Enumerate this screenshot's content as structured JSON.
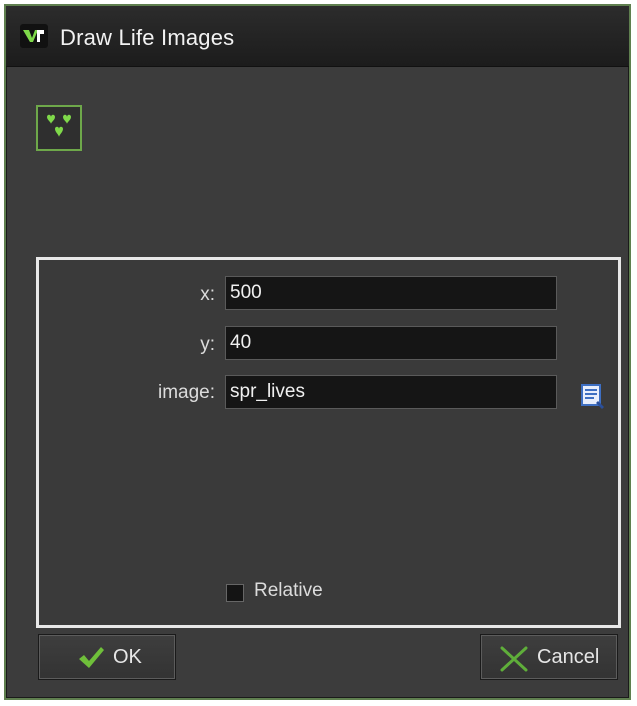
{
  "window": {
    "title": "Draw Life Images",
    "title_icon": "game-maker-icon",
    "action_icon": "life-images-icon"
  },
  "fields": {
    "x": {
      "label": "x:",
      "value": "500"
    },
    "y": {
      "label": "y:",
      "value": "40"
    },
    "image": {
      "label": "image:",
      "value": "spr_lives",
      "browse_icon": "browse-sprite-icon"
    }
  },
  "relative": {
    "label": "Relative",
    "checked": false
  },
  "buttons": {
    "ok_label": "OK",
    "cancel_label": "Cancel"
  },
  "colors": {
    "window_border": "#5f7f4f",
    "ok_check": "#6fbf3a",
    "cancel_x": "#5fae3a",
    "action_icon": "#6ea84a",
    "browse_icon": "#3e6fc2"
  }
}
